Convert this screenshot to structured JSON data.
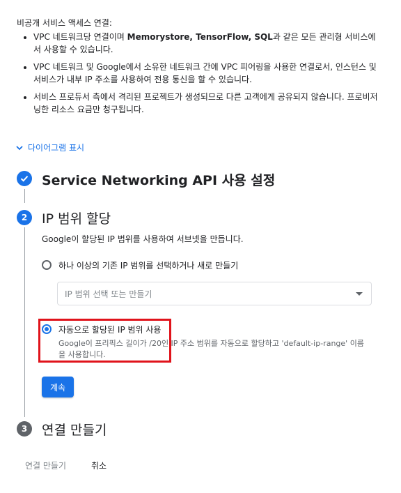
{
  "intro": {
    "heading": "비공개 서비스 액세스 연결:",
    "bullet1_pre": "VPC 네트워크당 연결이며 ",
    "bullet1_bold": "Memorystore, TensorFlow, SQL",
    "bullet1_post": "과 같은 모든 관리형 서비스에서 사용할 수 있습니다.",
    "bullet2": "VPC 네트워크 및 Google에서 소유한 네트워크 간에 VPC 피어링을 사용한 연결로서, 인스턴스 및 서비스가 내부 IP 주소를 사용하여 전용 통신을 할 수 있습니다.",
    "bullet3": "서비스 프로듀서 측에서 격리된 프로젝트가 생성되므로 다른 고객에게 공유되지 않습니다. 프로비저닝한 리소스 요금만 청구됩니다."
  },
  "diagram_toggle": {
    "label": "다이어그램 표시",
    "icon": "chevron-down-icon"
  },
  "steps": [
    {
      "number": "",
      "title": "Service Networking API 사용 설정",
      "state": "complete"
    },
    {
      "number": "2",
      "title": "IP 범위 할당",
      "state": "active"
    },
    {
      "number": "3",
      "title": "연결 만들기",
      "state": "pending"
    }
  ],
  "ip_range": {
    "description": "Google이 할당된 IP 범위를 사용하여 서브넷을 만듭니다.",
    "option_existing": "하나 이상의 기존 IP 범위를 선택하거나 새로 만들기",
    "select_placeholder": "IP 범위 선택 또는 만들기",
    "option_auto": "자동으로 할당된 IP 범위 사용",
    "option_auto_help": "Google이 프리픽스 길이가 /20인 IP 주소 범위를 자동으로 할당하고 'default-ip-range' 이름을 사용합니다.",
    "selected_option": "auto",
    "continue_label": "계속"
  },
  "footer": {
    "create_label": "연결 만들기",
    "cancel_label": "취소"
  },
  "colors": {
    "accent": "#1a73e8",
    "highlight": "#e0131b",
    "muted": "#5f6368",
    "line": "#9aa0a6"
  }
}
